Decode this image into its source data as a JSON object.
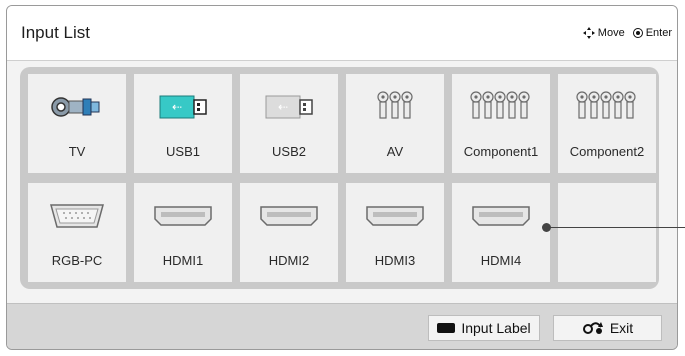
{
  "header": {
    "title": "Input List",
    "hints": [
      {
        "icon": "move-arrows-icon",
        "label": "Move"
      },
      {
        "icon": "enter-icon",
        "label": "Enter"
      }
    ]
  },
  "inputs": [
    {
      "id": "tv",
      "label": "TV",
      "icon": "antenna-connector-icon"
    },
    {
      "id": "usb1",
      "label": "USB1",
      "icon": "usb-connected-icon",
      "active_color": "#37c9c6"
    },
    {
      "id": "usb2",
      "label": "USB2",
      "icon": "usb-icon"
    },
    {
      "id": "av",
      "label": "AV",
      "icon": "rca-3-icon"
    },
    {
      "id": "component1",
      "label": "Component1",
      "icon": "rca-5-icon"
    },
    {
      "id": "component2",
      "label": "Component2",
      "icon": "rca-5-icon"
    },
    {
      "id": "rgb-pc",
      "label": "RGB-PC",
      "icon": "vga-icon"
    },
    {
      "id": "hdmi1",
      "label": "HDMI1",
      "icon": "hdmi-icon"
    },
    {
      "id": "hdmi2",
      "label": "HDMI2",
      "icon": "hdmi-icon"
    },
    {
      "id": "hdmi3",
      "label": "HDMI3",
      "icon": "hdmi-icon"
    },
    {
      "id": "hdmi4",
      "label": "HDMI4",
      "icon": "hdmi-icon"
    }
  ],
  "footer": {
    "input_label_button": "Input Label",
    "exit_button": "Exit"
  }
}
